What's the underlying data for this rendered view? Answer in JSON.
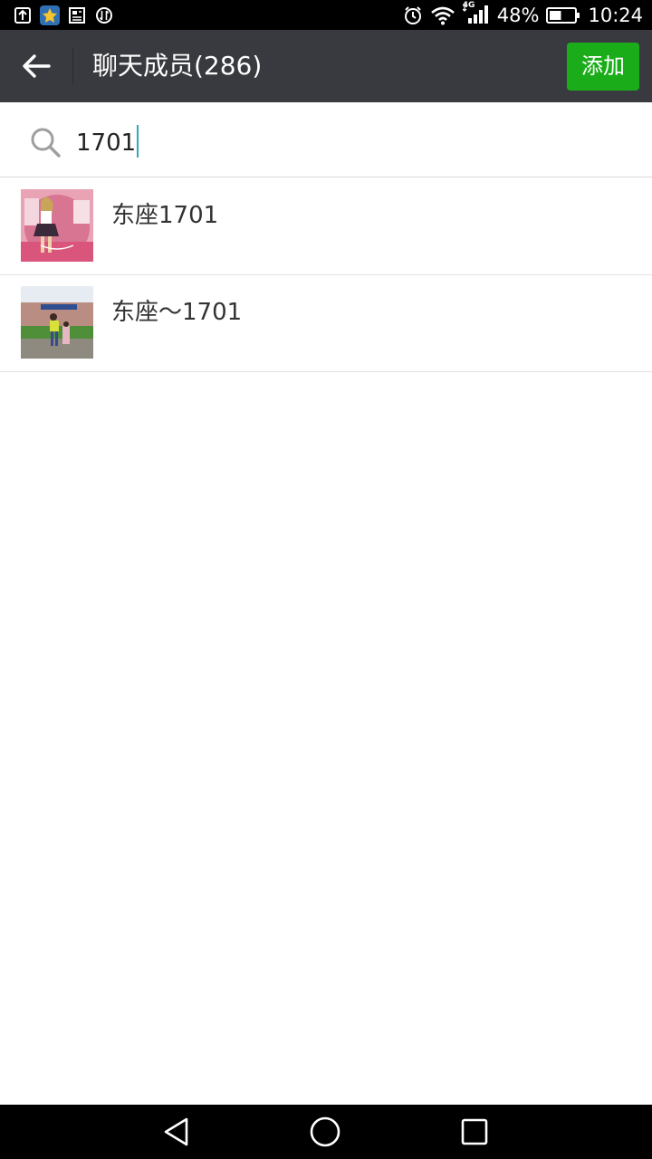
{
  "status_bar": {
    "left_icons": [
      "upload-notification-icon",
      "app-notification-icon",
      "news-notification-icon",
      "sync-notification-icon"
    ],
    "network_label": "4G",
    "battery_percent": "48%",
    "battery_level": 0.48,
    "time": "10:24"
  },
  "header": {
    "title": "聊天成员(286)",
    "add_label": "添加",
    "accent_color": "#1aad19"
  },
  "search": {
    "value": "1701"
  },
  "results": [
    {
      "name": "东座1701"
    },
    {
      "name": "东座～1701"
    }
  ],
  "nav": {
    "buttons": [
      "back-triangle-icon",
      "home-circle-icon",
      "recents-square-icon"
    ]
  }
}
